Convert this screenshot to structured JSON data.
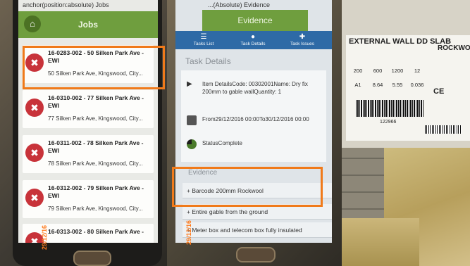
{
  "jobs_screen": {
    "caption": "anchor(position:absolute) Jobs",
    "title": "Jobs",
    "items": [
      {
        "title": "16-0283-002 - 50 Silken Park Ave - EWI",
        "address": "50 Silken Park Ave, Kingswood, City..."
      },
      {
        "title": "16-0310-002 - 77 Silken Park Ave - EWI",
        "address": "77 Silken Park Ave, Kingswood, City..."
      },
      {
        "title": "16-0311-002 - 78 Silken Park Ave - EWI",
        "address": "78 Silken Park Ave, Kingswood, City..."
      },
      {
        "title": "16-0312-002 - 79 Silken Park Ave - EWI",
        "address": "79 Silken Park Ave, Kingswood, City..."
      },
      {
        "title": "16-0313-002 - 80 Silken Park Ave -",
        "address": ""
      }
    ]
  },
  "evidence_screen": {
    "caption": "...(Absolute) Evidence",
    "title": "Evidence",
    "tabs": [
      "Tasks List",
      "Task Details",
      "Task Issues"
    ],
    "heading": "Task Details",
    "item_details": "Item DetailsCode: 00302001Name: Dry fix 200mm to gable wallQuantity: 1",
    "dates": "From29/12/2016 00:00To30/12/2016 00:00",
    "status": "StatusComplete",
    "evidence_heading": "Evidence",
    "evidence_items": [
      "+ Barcode 200mm Rockwool",
      "+ Entire gable from the ground",
      "+ Meter box and telecom box fully insulated"
    ]
  },
  "product_label": {
    "title": "EXTERNAL WALL DD SLAB",
    "brand": "ROCKWOOL",
    "values": [
      "200",
      "600",
      "1200",
      "12"
    ],
    "class": "A1",
    "values2": [
      "8.64",
      "5.55",
      "0.036"
    ],
    "code": "122966"
  },
  "date_stamps": [
    "29/12/16",
    "29/12/16"
  ],
  "colors": {
    "highlight": "#f07a1a",
    "appbar": "#6f9e3e",
    "tabbar": "#2e6aa6",
    "job_icon": "#c8333a"
  }
}
